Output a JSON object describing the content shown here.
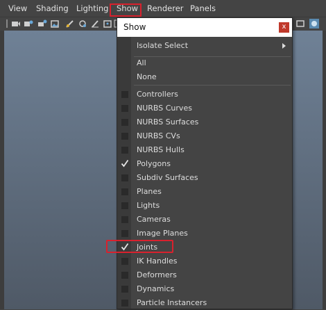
{
  "menubar": {
    "items": [
      {
        "label": "View"
      },
      {
        "label": "Shading"
      },
      {
        "label": "Lighting"
      },
      {
        "label": "Show"
      },
      {
        "label": "Renderer"
      },
      {
        "label": "Panels"
      }
    ]
  },
  "popup": {
    "title": "Show",
    "close_label": "x",
    "submenu": {
      "label": "Isolate Select"
    },
    "all_label": "All",
    "none_label": "None",
    "items": [
      {
        "label": "Controllers",
        "checked": false
      },
      {
        "label": "NURBS Curves",
        "checked": false
      },
      {
        "label": "NURBS Surfaces",
        "checked": false
      },
      {
        "label": "NURBS CVs",
        "checked": false
      },
      {
        "label": "NURBS Hulls",
        "checked": false
      },
      {
        "label": "Polygons",
        "checked": true
      },
      {
        "label": "Subdiv Surfaces",
        "checked": false
      },
      {
        "label": "Planes",
        "checked": false
      },
      {
        "label": "Lights",
        "checked": false
      },
      {
        "label": "Cameras",
        "checked": false
      },
      {
        "label": "Image Planes",
        "checked": false
      },
      {
        "label": "Joints",
        "checked": true
      },
      {
        "label": "IK Handles",
        "checked": false
      },
      {
        "label": "Deformers",
        "checked": false
      },
      {
        "label": "Dynamics",
        "checked": false
      },
      {
        "label": "Particle Instancers",
        "checked": false
      }
    ]
  },
  "colors": {
    "highlight": "#d9212d",
    "close_button": "#c0392b",
    "panel_bg": "#444444"
  }
}
